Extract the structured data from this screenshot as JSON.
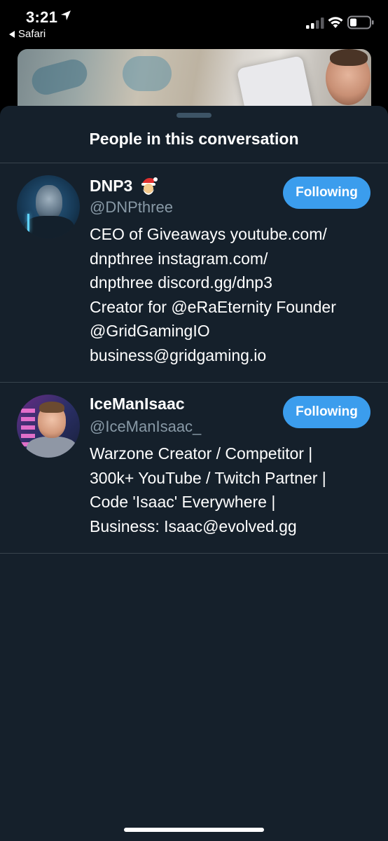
{
  "status_bar": {
    "time": "3:21",
    "back_app": "Safari",
    "icons": [
      "location-arrow-icon",
      "signal-icon",
      "wifi-icon",
      "battery-icon"
    ]
  },
  "sheet": {
    "title": "People in this conversation"
  },
  "people": [
    {
      "name": "DNP3",
      "name_emoji": "santa-emoji-icon",
      "handle": "@DNPthree",
      "bio": "CEO of Giveaways youtube.com/\ndnpthree instagram.com/\ndnpthree discord.gg/dnp3\nCreator for @eRaEternity Founder\n@GridGamingIO\nbusiness@gridgaming.io",
      "button_label": "Following"
    },
    {
      "name": "IceManIsaac",
      "handle": "@IceManIsaac_",
      "bio": "Warzone Creator / Competitor |\n300k+ YouTube / Twitch Partner |\nCode 'Isaac' Everywhere |\nBusiness: Isaac@evolved.gg",
      "button_label": "Following"
    }
  ],
  "colors": {
    "sheet_background": "#15202b",
    "accent": "#3b9ded",
    "secondary_text": "#8899a6",
    "divider": "#38444d"
  }
}
